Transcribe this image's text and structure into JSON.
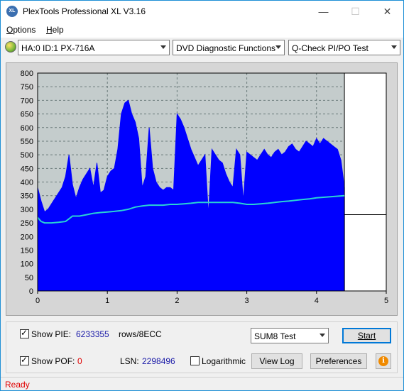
{
  "window": {
    "title": "PlexTools Professional XL V3.16",
    "icon_label": "XL",
    "minimize": "—",
    "maximize": "☐",
    "close": "✕"
  },
  "menu": {
    "items": [
      {
        "label": "Options",
        "accel": "O",
        "rest": "ptions"
      },
      {
        "label": "Help",
        "accel": "H",
        "rest": "elp"
      }
    ]
  },
  "toolbar": {
    "device": "HA:0 ID:1  PX-716A",
    "function": "DVD Diagnostic Functions",
    "test": "Q-Check PI/PO Test"
  },
  "chart_data": {
    "type": "area",
    "xlim": [
      0,
      5
    ],
    "ylim": [
      0,
      800
    ],
    "x_ticks": [
      "0",
      "1",
      "2",
      "3",
      "4",
      "5"
    ],
    "y_ticks": [
      "0",
      "50",
      "100",
      "150",
      "200",
      "250",
      "300",
      "350",
      "400",
      "450",
      "500",
      "550",
      "600",
      "650",
      "700",
      "750",
      "800"
    ],
    "grid": true,
    "colors": {
      "pie": "#0000ff",
      "speed": "#29d3d3",
      "plot_bg": "#c4cccc",
      "grid": "#6a7a7a"
    },
    "data_end_x": 4.4,
    "pie_series": {
      "name": "PIE",
      "x": [
        0.0,
        0.05,
        0.1,
        0.15,
        0.2,
        0.25,
        0.3,
        0.35,
        0.4,
        0.45,
        0.5,
        0.55,
        0.6,
        0.65,
        0.7,
        0.75,
        0.8,
        0.85,
        0.9,
        0.95,
        1.0,
        1.05,
        1.1,
        1.15,
        1.2,
        1.25,
        1.3,
        1.35,
        1.4,
        1.45,
        1.5,
        1.55,
        1.6,
        1.65,
        1.7,
        1.75,
        1.8,
        1.85,
        1.9,
        1.95,
        2.0,
        2.05,
        2.1,
        2.15,
        2.2,
        2.25,
        2.3,
        2.35,
        2.4,
        2.45,
        2.5,
        2.55,
        2.6,
        2.65,
        2.7,
        2.75,
        2.8,
        2.85,
        2.9,
        2.95,
        3.0,
        3.05,
        3.1,
        3.15,
        3.2,
        3.25,
        3.3,
        3.35,
        3.4,
        3.45,
        3.5,
        3.55,
        3.6,
        3.65,
        3.7,
        3.75,
        3.8,
        3.85,
        3.9,
        3.95,
        4.0,
        4.05,
        4.1,
        4.15,
        4.2,
        4.25,
        4.3,
        4.35,
        4.4
      ],
      "y": [
        380,
        330,
        290,
        300,
        320,
        340,
        360,
        380,
        420,
        500,
        390,
        340,
        380,
        410,
        430,
        450,
        380,
        470,
        360,
        370,
        420,
        440,
        450,
        520,
        650,
        690,
        700,
        650,
        620,
        560,
        380,
        420,
        600,
        450,
        400,
        380,
        370,
        380,
        380,
        370,
        650,
        630,
        600,
        560,
        520,
        490,
        460,
        480,
        500,
        280,
        520,
        500,
        480,
        470,
        430,
        400,
        380,
        520,
        500,
        330,
        510,
        500,
        490,
        480,
        500,
        520,
        500,
        490,
        510,
        520,
        500,
        510,
        530,
        540,
        520,
        510,
        530,
        550,
        540,
        530,
        560,
        540,
        560,
        550,
        540,
        530,
        520,
        480,
        380
      ]
    },
    "speed_series": {
      "name": "Speed",
      "x": [
        0.0,
        0.05,
        0.1,
        0.2,
        0.3,
        0.4,
        0.45,
        0.5,
        0.6,
        0.7,
        0.8,
        0.9,
        1.0,
        1.1,
        1.2,
        1.3,
        1.4,
        1.5,
        1.6,
        1.7,
        1.8,
        1.9,
        2.0,
        2.1,
        2.2,
        2.3,
        2.4,
        2.5,
        2.6,
        2.7,
        2.8,
        2.9,
        3.0,
        3.1,
        3.2,
        3.3,
        3.4,
        3.5,
        3.6,
        3.7,
        3.8,
        3.9,
        4.0,
        4.1,
        4.2,
        4.3,
        4.4
      ],
      "y": [
        270,
        255,
        250,
        250,
        252,
        255,
        265,
        275,
        275,
        280,
        285,
        288,
        290,
        292,
        295,
        300,
        308,
        312,
        315,
        315,
        315,
        318,
        318,
        320,
        322,
        325,
        325,
        325,
        325,
        325,
        325,
        322,
        318,
        318,
        320,
        322,
        325,
        328,
        330,
        333,
        336,
        338,
        342,
        344,
        346,
        348,
        350
      ]
    },
    "end_marker_y": 280
  },
  "bottom": {
    "show_pie_label": "Show PIE:",
    "pie_value": "6233355",
    "rows_label": "rows/8ECC",
    "show_pof_label": "Show POF:",
    "pof_value": "0",
    "lsn_label": "LSN:",
    "lsn_value": "2298496",
    "log_label": "Logarithmic",
    "sum8_option": "SUM8 Test",
    "start_button": "Start",
    "view_log_button": "View Log",
    "preferences_button": "Preferences",
    "info_label": "i"
  },
  "status": {
    "text": "Ready"
  }
}
